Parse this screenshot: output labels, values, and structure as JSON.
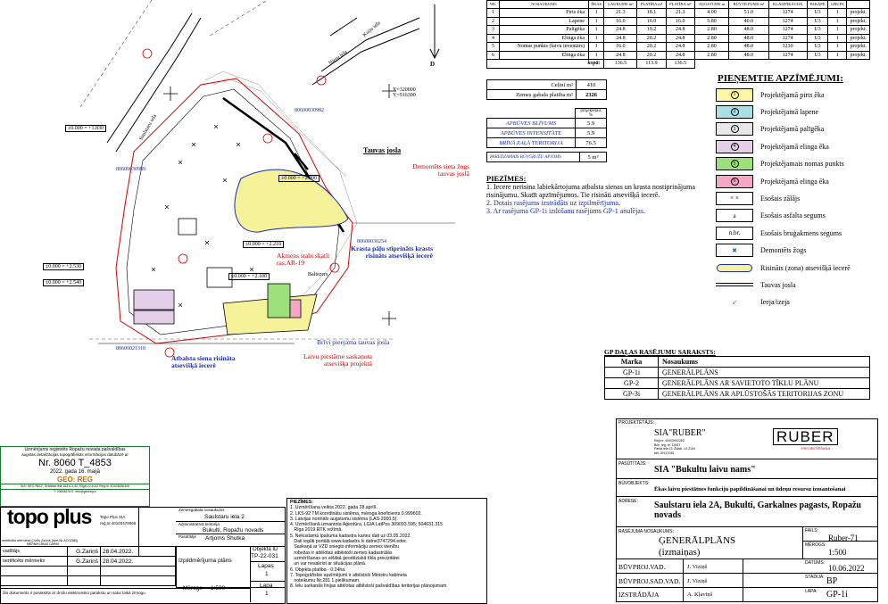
{
  "building_table": {
    "headers": [
      "NR.",
      "NOSAUKUMS",
      "ĒKAS",
      "LAUKUMS m²",
      "PLATĪBA m²",
      "PLATĪBA m²",
      "AUGSTUMS m",
      "BŪVTILPUMS m³",
      "KLASIFIKĀCIJA",
      "PAKĀPE",
      "GRUPA",
      ""
    ],
    "rows": [
      [
        "1",
        "Pirts ēka",
        "1",
        "21.3",
        "18.1",
        "21.3",
        "4.00",
        "51.0",
        "1274",
        "U3",
        "1",
        "projekt."
      ],
      [
        "2",
        "Lapene",
        "1",
        "16.0",
        "16.0",
        "16.0",
        "5.80",
        "40.0",
        "1274",
        "U3",
        "1",
        "projekt."
      ],
      [
        "3",
        "Palīgēka",
        "1",
        "24.8",
        "19.2",
        "24.8",
        "2.80",
        "48.0",
        "1274",
        "U3",
        "1",
        "projekt."
      ],
      [
        "4",
        "Elinga ēka",
        "1",
        "24.8",
        "20.2",
        "24.8",
        "2.80",
        "48.0",
        "1274",
        "U3",
        "1",
        "projekt."
      ],
      [
        "5",
        "Nomas punkts (laivu inventārs)",
        "1",
        "16.0",
        "20.2",
        "24.8",
        "2.80",
        "48.0",
        "1230",
        "U3",
        "1",
        "projekt."
      ],
      [
        "6",
        "Elinga ēka",
        "1",
        "24.8",
        "20.2",
        "24.8",
        "2.80",
        "48.0",
        "1274",
        "U3",
        "1",
        "projekt."
      ]
    ],
    "total_label": "kopā:",
    "totals": [
      "136.5",
      "113.9",
      "136.5"
    ]
  },
  "site_summary": {
    "rows": [
      {
        "label": "Ceļini m²",
        "value": "410"
      },
      {
        "label": "Zemes gabala platība m²",
        "value": "2326"
      }
    ],
    "percent_header": "projektētais %",
    "indicators": [
      {
        "label": "APBŪVES BLĪVUMS",
        "value": "5.9"
      },
      {
        "label": "APBŪVES INTENSITĀTE",
        "value": "5.9"
      },
      {
        "label": "BRĪVĀ ZAĻĀ TERITORIJA",
        "value": "76.5"
      }
    ],
    "parking_label": "PAREDZAMAIS BŪVGRUŽU APJOMS",
    "parking_value": "5 m³"
  },
  "notes": {
    "title": "PIEZĪMES:",
    "items": [
      "1.  Iecere nerisina labiekārtojuma atbalsta sienas un krasta nostiprinājuma risinājumu. Skatīt apzīmējumos. Tie risināti atsevišķā iecerē.",
      "2.  Dotais rasējums izstrādāts uz izpilmērījuma.",
      "3.  Ar rasējuma GP-1i izdošanu rasējums GP-1 anulējas."
    ]
  },
  "legend": {
    "title": "PIEŅEMTIE APZĪMĒJUMI:",
    "items": [
      {
        "symbol": "1",
        "label": "Projektējamā pirts ēka",
        "color": "#fff6a8"
      },
      {
        "symbol": "2",
        "label": "Projektējamā lapene",
        "color": "#a8e0e6"
      },
      {
        "symbol": "3",
        "label": "Projektējamā palīgēka",
        "color": "#e8e8e8"
      },
      {
        "symbol": "4",
        "label": "Projektējamā elinga ēka",
        "color": "#e4cfe8"
      },
      {
        "symbol": "5",
        "label": "Projektējamais nomas punkts",
        "color": "#9be07a"
      },
      {
        "symbol": "6",
        "label": "Projektējamā elinga ēka",
        "color": "#f2a8c4"
      },
      {
        "symbol": "× ×",
        "label": "Esošais zālājs",
        "color": "#ffffff"
      },
      {
        "symbol": "a",
        "label": "Esošais asfalta segums",
        "color": "#ffffff"
      },
      {
        "symbol": "n.br.",
        "label": "Esošais bruģakmens segums",
        "color": "#ffffff"
      },
      {
        "symbol": "✖",
        "label": "Demontēts žogs",
        "color": "#ffffff"
      },
      {
        "symbol": "",
        "label": "Risināts (zona) atsevišķā iecerē",
        "color": "#f5f29a"
      },
      {
        "symbol": "",
        "label": "Tauvas josla",
        "color": "#ffffff"
      },
      {
        "symbol": "↙",
        "label": "Ieeja/izeja",
        "color": "#ffffff"
      }
    ]
  },
  "gp_list": {
    "title": "GP DAĻAS RASĒJUMU SARAKSTS:",
    "headers": [
      "Marka",
      "Nosaukums"
    ],
    "rows": [
      [
        "GP-1i",
        "ĢENERĀLPLĀNS"
      ],
      [
        "GP-2",
        "ĢENERĀLPLĀNS AR SAVIETOTO TĪKLU PLĀNU"
      ],
      [
        "GP-3i",
        "ĢENERĀLPLĀNS AR APLŪSTOŠĀS TERITORIJAS ZONU"
      ]
    ]
  },
  "title_block": {
    "designer_label": "PROJEKTĒTĀJS:",
    "designer": "SIA\"RUBER\"",
    "designer_details": "Reģ.nr. 40003902283\nBūv. reģ. nr. 13937\nParka iela 13, Ādaži, LV-2164\ntālr. 29147030",
    "logo_text": "RUBER",
    "logo_sub": "PROJEKTĒŠANA",
    "client_label": "PASŪTĪTĀJS:",
    "client": "SIA \"Bukultu laivu nams\"",
    "object_label": "BŪVOBJEKTS:",
    "object": "Ēkas laivu piestātnes funkciju papildināšanai un ūdeņu resursu izmantošanai",
    "address_label": "ADRESE:",
    "address": "Saulstaru iela 2A, Bukulti, Garkalnes pagasts, Ropažu novads",
    "drawing_label": "RASĒJUMA NOSAUKUMS:",
    "drawing_name": "ĢENERĀLPLĀNS",
    "drawing_sub": "(izmaiņas)",
    "file_label": "FAILS:",
    "file": "Ruber-71",
    "scale_label": "MĒROGS:",
    "scale": "1:500",
    "date_label": "DATUMS:",
    "date": "10.06.2022",
    "stage_label": "STADIJA:",
    "stage": "BP",
    "sheet_label": "LAPA:",
    "sheet": "GP-1i",
    "roles": [
      {
        "role": "BŪVPROJ.VAD.",
        "name": "J. Viziņš"
      },
      {
        "role": "BŪVPROJ.SAD.VAD.",
        "name": "J. Viziņš"
      },
      {
        "role": "IZSTRĀDĀJA",
        "name": "A. Kļaviņš"
      }
    ]
  },
  "survey_stamp": {
    "line1": "Uzmērījums reģistrēts Ropažu novada pašvaldības",
    "line2": "augstas detalizācijas topogrāfiskās informācijas datubāzē ar",
    "number": "Nr. 8060 T_4853",
    "date": "2022. gada 16. maijā",
    "geo": "GEO: REG",
    "org": "SIA \"GEO REG\", Brīvības iela 163 k-1-42, Rīga LV-1012 Reģ.nr. 40103836349",
    "contact": "T: 20654676  E: info@georeg.lv"
  },
  "left_block": {
    "logo": "topo plus",
    "logo_sub": "MĒRNIECĪBAS DARBI",
    "company": "Topo Plus SIA",
    "reg": "reģ.nr.40103479066",
    "measurer_label": "sertificēts mērnieks (Jurīs Zariņš (sert.Nr.AC0286))",
    "roles": [
      {
        "role": "vadītājs",
        "name": "G.Zariņš",
        "date": "28.04.2022."
      },
      {
        "role": "sertificēts mērnieks",
        "name": "G.Zariņš",
        "date": "28.04.2022."
      }
    ],
    "property_label": "Zemesgabala nosaukums",
    "property": "Saulstaru iela 2",
    "territory_label": "Administratīvā teritorija",
    "territory": "Bukulti, Ropažu novads",
    "client_label": "Pasūtītājs",
    "client": "Artjoms Shutka",
    "plan_type": "Izpildmērījuma plāns",
    "object_id_label": "Objekta ID",
    "object_id": "TP-22-031",
    "pages_label": "Lapas",
    "pages": "1",
    "page_label": "Lapa",
    "page": "1",
    "scale_label": "Mērogs",
    "scale": "1:500",
    "footer": "Šis dokuments ir parakstīts ar drošu elektronisko parakstu un satur laika zīmogu"
  },
  "survey_notes": {
    "title": "PIEZĪMES:",
    "items": [
      "1. Uzmērīšana veikta 2022. gada 28.aprīlī.",
      "2. LKS-92 TM koordinātu sistēma, mēroga koeficients 0.999602.",
      "3. Latvijas normālo augstumu sistēma (LAS-2000,5).",
      "4. Uzmērīšanā izmantota Aģentūra, LGIA LatPos 309093.595; 504631.315",
      "   Rīga 2019 RTK režīmā.",
      "5. Nekustamā īpašuma kadastra kartes dati uz 03.05.2022.",
      "   Dati iegūti portālā www.kadastrs.lv datne3747294.edoc",
      "   Saskaņā ar VZD sniegto informāciju zemes vienību",
      "   robežas ir attēlotas atbilstoši zemes kadastrālās",
      "   uzmērīšanas un vēlākā ģeodēziskā tīkla precizitātei",
      "   un var nesakrist ar situācijas plānā.",
      "6. Objekta platība - 0.24ha.",
      "7. Topogrāfiskie apzīmējumi ir atbilstoši Ministru kabineta",
      "   noteikumu Nr.281 1.pielikumam.",
      "8. Ielu sarkanās līnijas attēlotas atbilstoši pašvaldības teritorijas plānojumam."
    ]
  },
  "map": {
    "street_nieru": "Nieru iela",
    "street_kaija": "Kaiju iela",
    "street_saulstaru": "Saulstaru iela",
    "coords": "X=320000\nY=516300",
    "north": "D",
    "labels": {
      "tauvas": "Tauvas josla",
      "demont": "Demontēts sieta žogs tauvas joslā",
      "krasts": "Krasta pāļu stiprināts krasts risināts atsevišķā iecerē",
      "akmens": "Akmens stabi skatīt ras.AR-19",
      "baltezers": "Baltezers",
      "brivi": "Brīvi pieejama tauvas josla",
      "siena": "Atbalsta siena risināta atsevišķā iecerē",
      "laivu": "Laivu piestātne saskaņota atsevišķa projektā"
    },
    "levels": [
      "±0.000 = +1.830",
      "±0.000 = +2.000",
      "±0.000 = +2.210",
      "±0.000 = +2.530",
      "±0.000 = +2.540",
      "±0.000 = +2.100"
    ],
    "parcels": [
      "80600030982",
      "80600030989",
      "80600030254",
      "80600021318"
    ]
  }
}
